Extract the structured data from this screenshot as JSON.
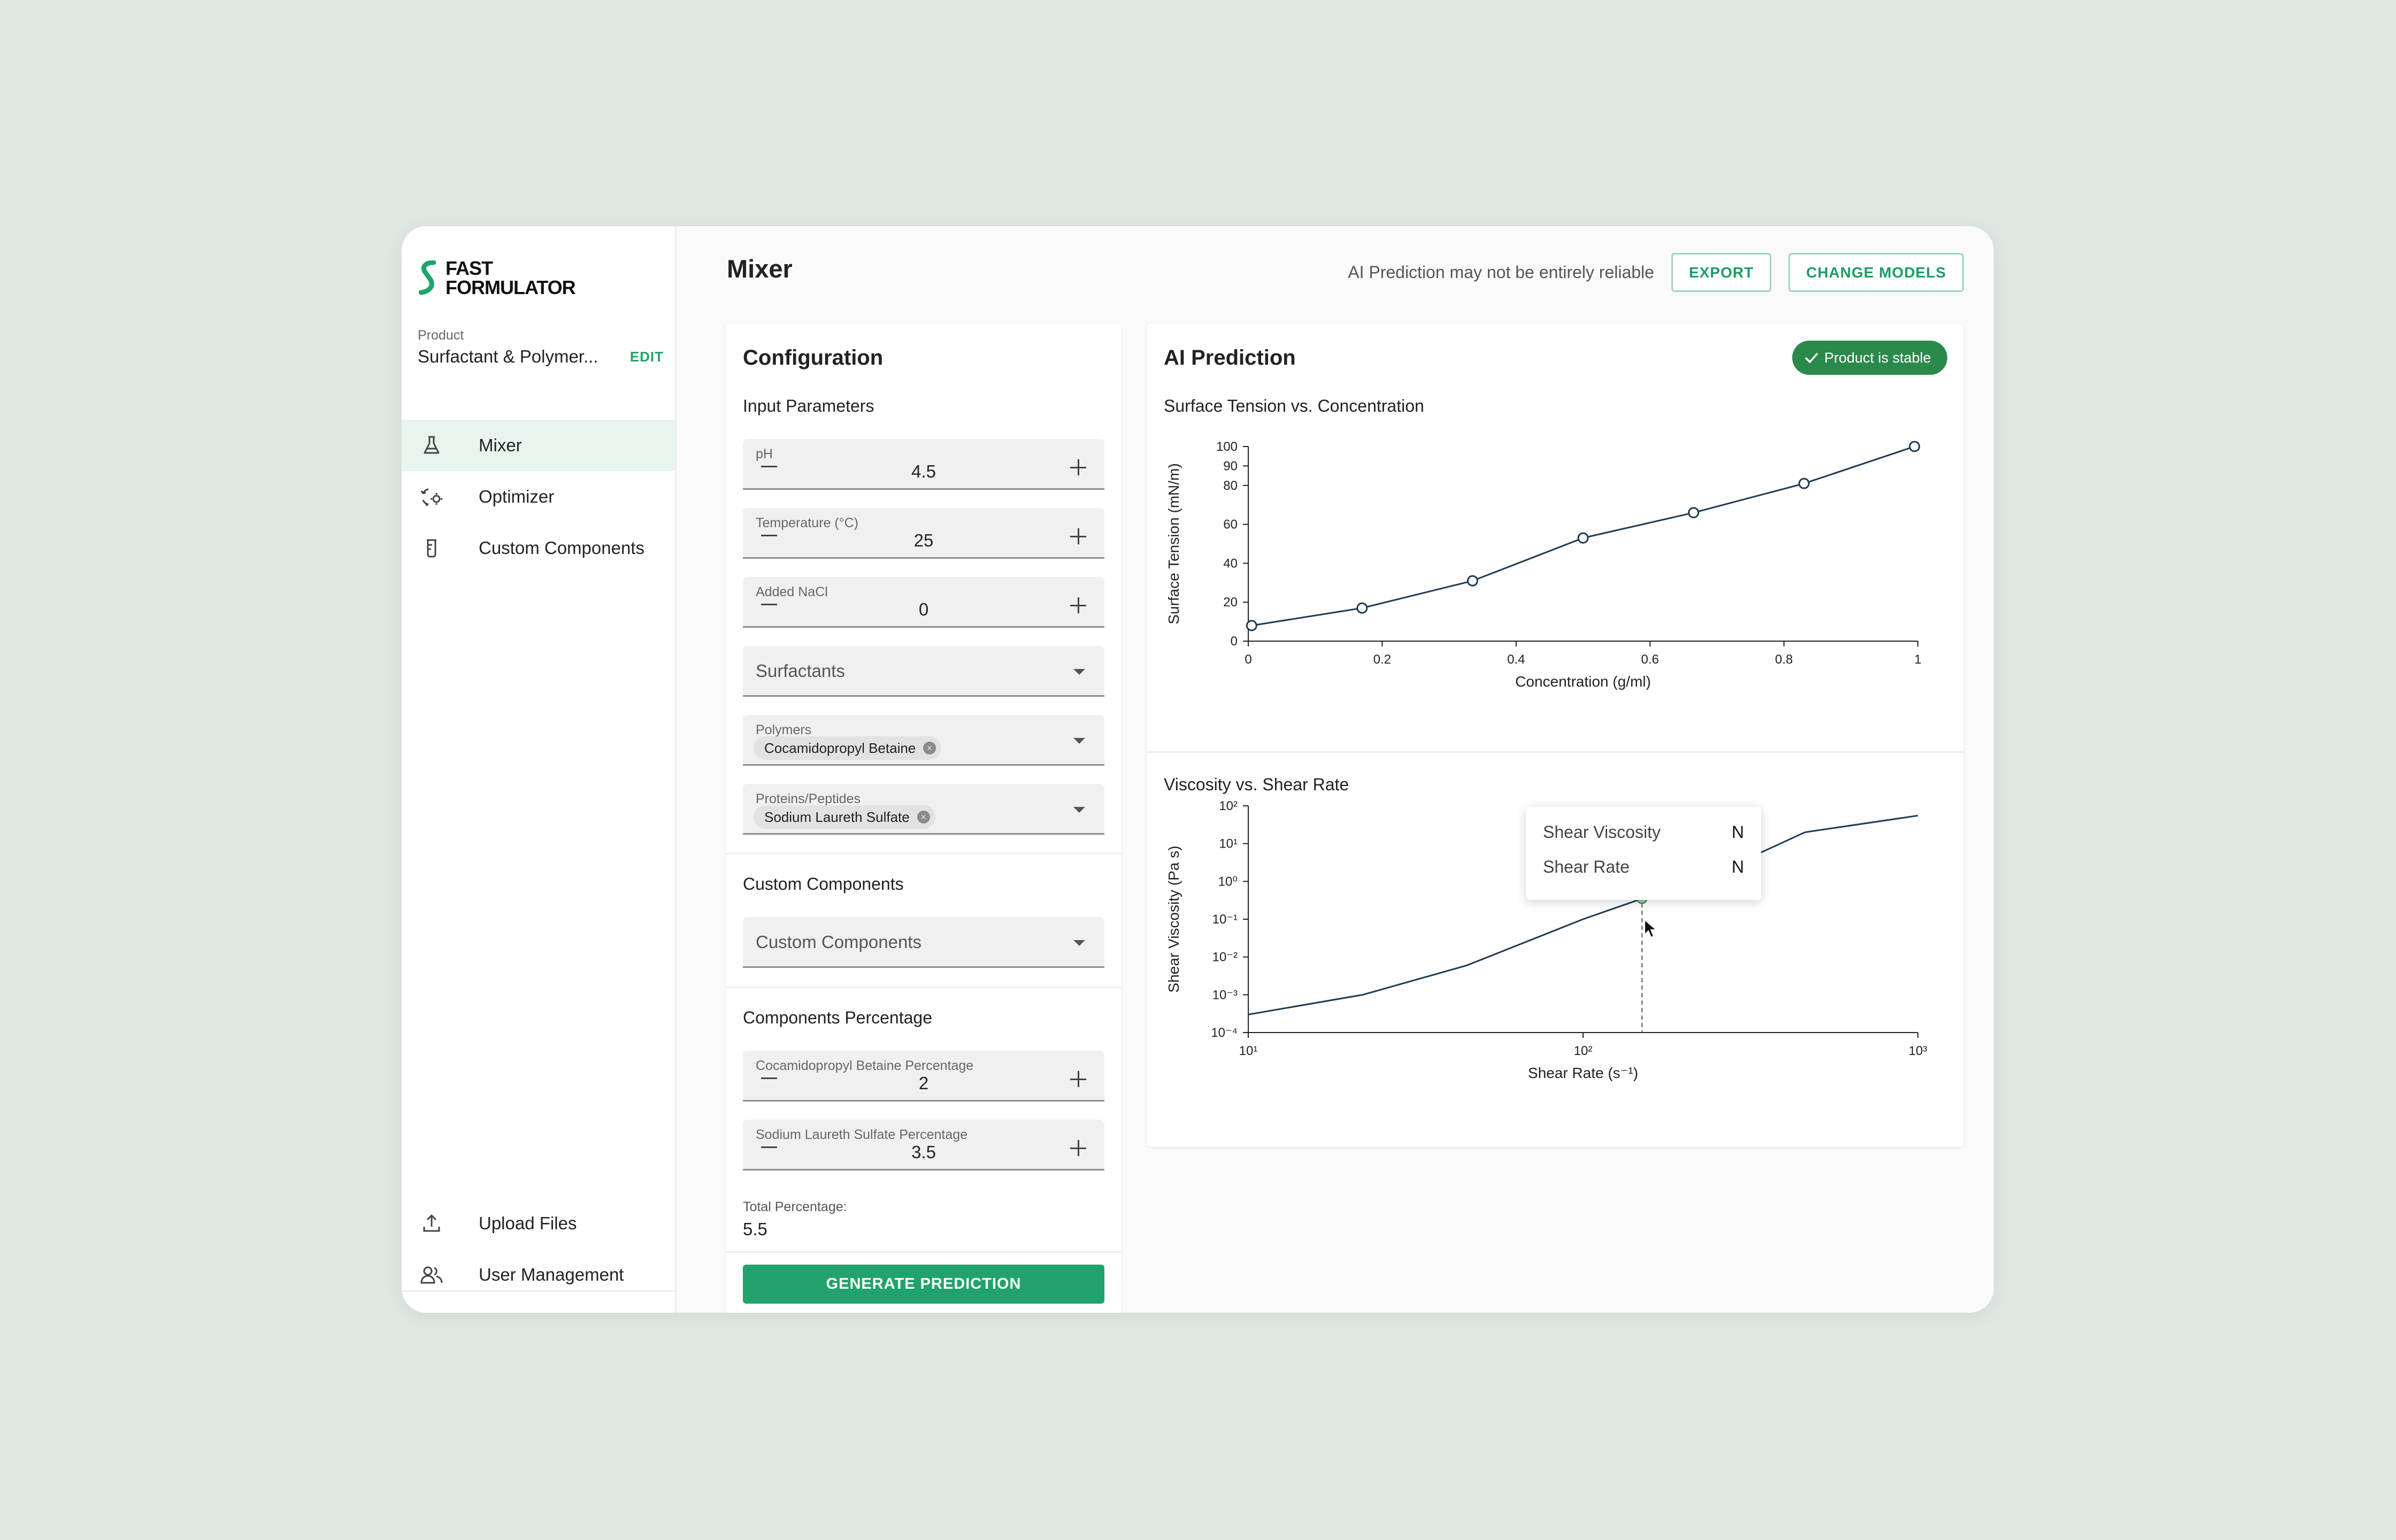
{
  "brand": {
    "line1": "FAST",
    "line2": "FORMULATOR",
    "accent": "#1da56a"
  },
  "product": {
    "label": "Product",
    "name": "Surfactant & Polymer...",
    "edit": "EDIT"
  },
  "nav": {
    "items": [
      {
        "label": "Mixer",
        "icon": "flask-icon",
        "active": true
      },
      {
        "label": "Optimizer",
        "icon": "optimizer-icon",
        "active": false
      },
      {
        "label": "Custom Components",
        "icon": "beaker-icon",
        "active": false
      }
    ],
    "bottom": [
      {
        "label": "Upload Files",
        "icon": "upload-icon"
      },
      {
        "label": "User Management",
        "icon": "users-icon"
      }
    ]
  },
  "header": {
    "title": "Mixer",
    "warning": "AI Prediction may not be entirely reliable",
    "export": "EXPORT",
    "change_models": "CHANGE MODELS"
  },
  "config": {
    "title": "Configuration",
    "input_params": "Input Parameters",
    "ph": {
      "label": "pH",
      "value": "4.5"
    },
    "temperature": {
      "label": "Temperature (°C)",
      "value": "25"
    },
    "nacl": {
      "label": "Added NaCl",
      "value": "0"
    },
    "surfactants": {
      "placeholder": "Surfactants"
    },
    "polymers": {
      "label": "Polymers",
      "chip": "Cocamidopropyl Betaine"
    },
    "proteins": {
      "label": "Proteins/Peptides",
      "chip": "Sodium Laureth Sulfate"
    },
    "custom_components_title": "Custom Components",
    "custom_components": {
      "placeholder": "Custom Components"
    },
    "percentages_title": "Components Percentage",
    "cocamidopropyl_pct": {
      "label": "Cocamidopropyl Betaine Percentage",
      "value": "2"
    },
    "sles_pct": {
      "label": "Sodium Laureth Sulfate Percentage",
      "value": "3.5"
    },
    "total_label": "Total Percentage:",
    "total_value": "5.5",
    "generate": "GENERATE PREDICTION"
  },
  "ai": {
    "title": "AI Prediction",
    "badge": "Product is stable",
    "badge_color": "#2b8a4b",
    "line_color": "#1f3a52"
  },
  "tooltip": {
    "rows": [
      {
        "label": "Shear Viscosity",
        "value": "N"
      },
      {
        "label": "Shear Rate",
        "value": "N"
      }
    ]
  },
  "chart_data": [
    {
      "type": "line",
      "title": "Surface Tension vs. Concentration",
      "xlabel": "Concentration (g/ml)",
      "ylabel": "Surface Tension (mN/m)",
      "xlim": [
        0,
        1
      ],
      "ylim": [
        0,
        100
      ],
      "xticks": [
        "0",
        "0.2",
        "0.4",
        "0.6",
        "0.8",
        "1"
      ],
      "xtick_values": [
        0,
        0.2,
        0.4,
        0.6,
        0.8,
        1
      ],
      "yticks": [
        "0",
        "20",
        "40",
        "60",
        "80",
        "90",
        "100"
      ],
      "ytick_values": [
        0,
        20,
        40,
        60,
        80,
        90,
        100
      ],
      "x": [
        0.005,
        0.17,
        0.335,
        0.5,
        0.665,
        0.83,
        0.995
      ],
      "y": [
        8,
        17,
        31,
        53,
        66,
        81,
        100
      ],
      "markers": true,
      "grid": false
    },
    {
      "type": "line",
      "title": "Viscosity vs. Shear Rate",
      "xlabel": "Shear Rate (s⁻¹)",
      "ylabel": "Shear Viscosity (Pa s)",
      "xscale": "log",
      "yscale": "log",
      "xlim": [
        10,
        1000
      ],
      "ylim": [
        0.0001,
        100
      ],
      "xticks": [
        "10¹",
        "10²",
        "10³"
      ],
      "xtick_values": [
        10,
        100,
        1000
      ],
      "yticks": [
        "10²",
        "10¹",
        "10⁰",
        "10⁻¹",
        "10⁻²",
        "10⁻³",
        "10⁻⁴"
      ],
      "ytick_values": [
        100,
        10,
        1,
        0.1,
        0.01,
        0.001,
        0.0001
      ],
      "x": [
        10,
        22,
        45,
        100,
        150,
        215,
        300,
        460,
        1000
      ],
      "y": [
        0.0003,
        0.001,
        0.006,
        0.1,
        0.35,
        0.9,
        3.5,
        20,
        55
      ],
      "hover": {
        "x": 150,
        "y": 0.35
      },
      "markers": false,
      "grid": false
    }
  ]
}
